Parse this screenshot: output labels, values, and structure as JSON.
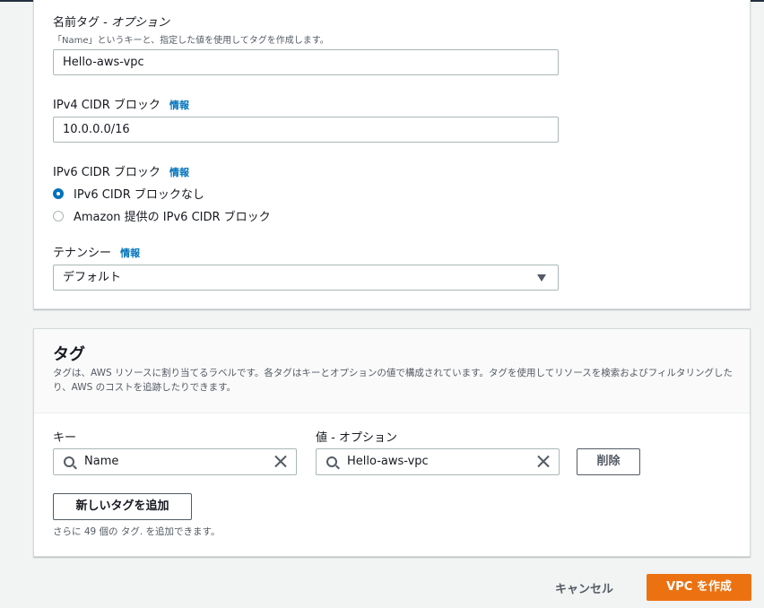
{
  "colors": {
    "accent": "#0073bb",
    "primary": "#ec7211",
    "border": "#aab7b8"
  },
  "vpc": {
    "name_tag": {
      "label": "名前タグ - ",
      "label_optional": "オプション",
      "description": "「Name」というキーと、指定した値を使用してタグを作成します。",
      "value": "Hello-aws-vpc"
    },
    "ipv4": {
      "label": "IPv4 CIDR ブロック",
      "info": "情報",
      "value": "10.0.0.0/16"
    },
    "ipv6": {
      "label": "IPv6 CIDR ブロック",
      "info": "情報",
      "options": [
        {
          "label": "IPv6 CIDR ブロックなし",
          "selected": true
        },
        {
          "label": "Amazon 提供の IPv6 CIDR ブロック",
          "selected": false
        }
      ]
    },
    "tenancy": {
      "label": "テナンシー",
      "info": "情報",
      "value": "デフォルト"
    }
  },
  "tags": {
    "title": "タグ",
    "description": "タグは、AWS リソースに割り当てるラベルです。各タグはキーとオプションの値で構成されています。タグを使用してリソースを検索およびフィルタリングしたり、AWS のコストを追跡したりできます。",
    "key_label": "キー",
    "value_label": "値 - オプション",
    "rows": [
      {
        "key": "Name",
        "value": "Hello-aws-vpc",
        "remove_label": "削除"
      }
    ],
    "add_label": "新しいタグを追加",
    "remaining": "さらに 49 個の タグ. を追加できます。"
  },
  "footer": {
    "cancel_label": "キャンセル",
    "create_label": "VPC を作成"
  }
}
